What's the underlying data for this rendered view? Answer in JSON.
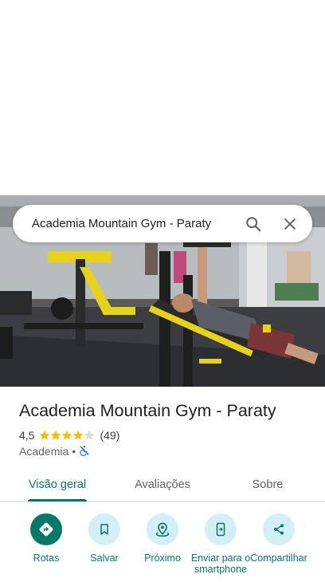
{
  "search": {
    "query": "Academia Mountain Gym - Paraty"
  },
  "place": {
    "name": "Academia Mountain Gym - Paraty",
    "rating": "4,5",
    "rating_stars": 4.5,
    "review_count": "(49)",
    "category": "Academia",
    "separator": "•",
    "accessibility_icon": "wheelchair-not-accessible-icon"
  },
  "tabs": [
    {
      "label": "Visão geral",
      "active": true
    },
    {
      "label": "Avaliações",
      "active": false
    },
    {
      "label": "Sobre",
      "active": false
    }
  ],
  "actions": [
    {
      "label": "Rotas",
      "icon": "directions-icon"
    },
    {
      "label": "Salvar",
      "icon": "bookmark-icon"
    },
    {
      "label": "Próximo",
      "icon": "nearby-icon"
    },
    {
      "label": "Enviar para o smartphone",
      "icon": "send-to-phone-icon"
    },
    {
      "label": "Compartilhar",
      "icon": "share-icon"
    }
  ],
  "colors": {
    "accent": "#00796b",
    "action_circle": "#d2eef7",
    "star": "#fbbc04"
  }
}
